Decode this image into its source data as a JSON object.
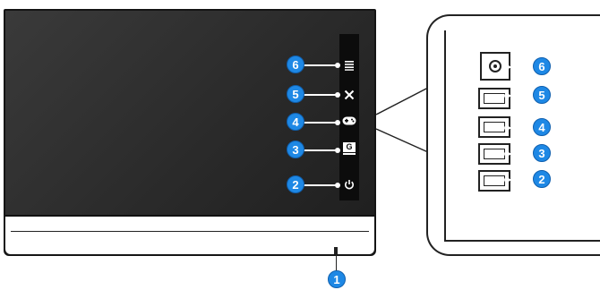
{
  "monitor": {
    "buttons": [
      {
        "number": "6",
        "icon": "menu-icon"
      },
      {
        "number": "5",
        "icon": "close-icon"
      },
      {
        "number": "4",
        "icon": "gamepad-icon"
      },
      {
        "number": "3",
        "icon": "gameplus-icon",
        "glyph": "G"
      },
      {
        "number": "2",
        "icon": "power-icon"
      }
    ],
    "power_indicator": {
      "number": "1"
    }
  },
  "side_view": {
    "buttons": [
      {
        "number": "6",
        "icon": "joystick-icon"
      },
      {
        "number": "5"
      },
      {
        "number": "4"
      },
      {
        "number": "3"
      },
      {
        "number": "2"
      }
    ]
  },
  "colors": {
    "badge": "#1e88e5",
    "screen": "#2a2a2a",
    "button_strip": "#0c0c0c"
  }
}
